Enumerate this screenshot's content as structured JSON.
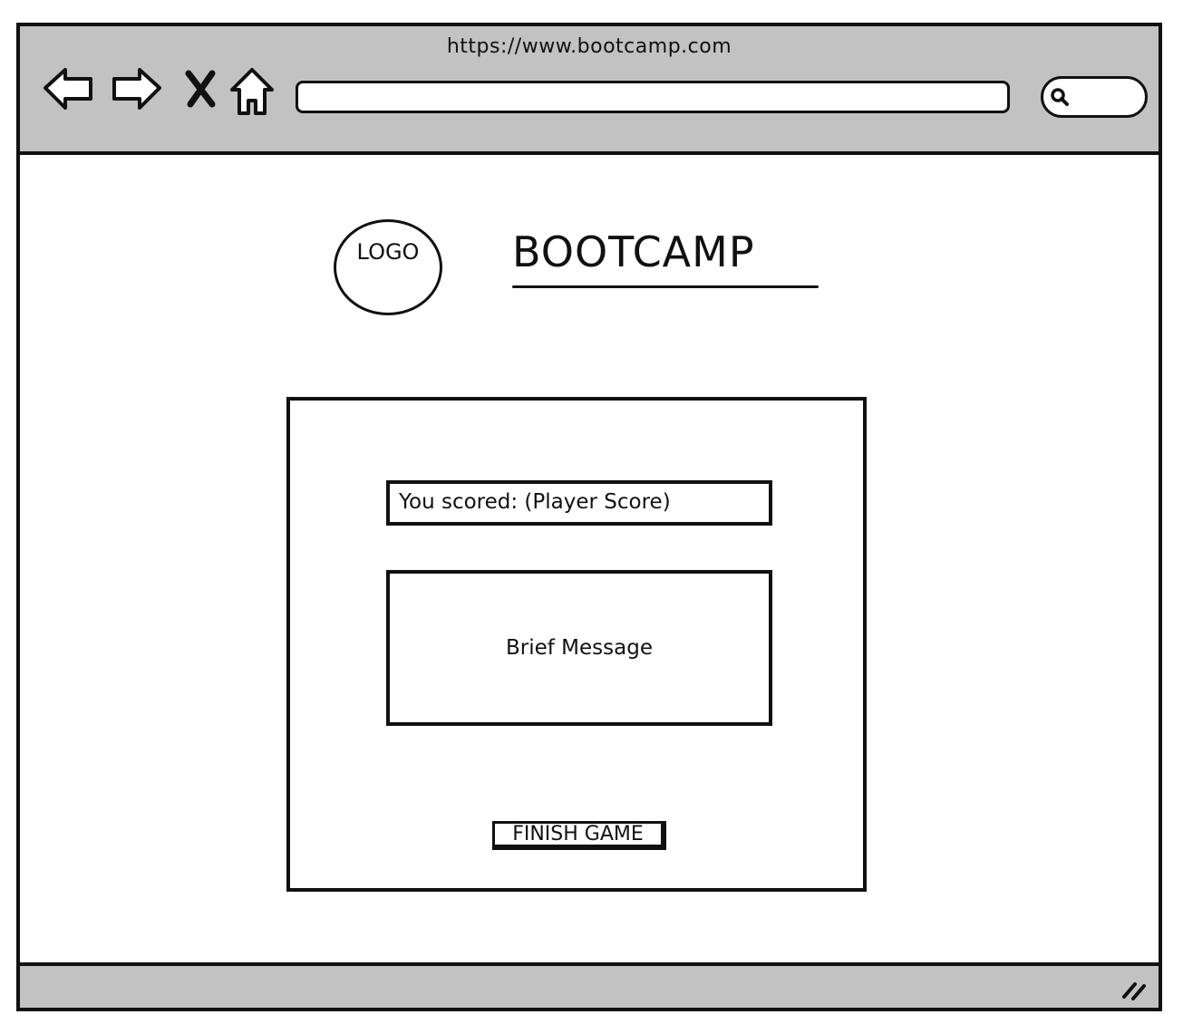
{
  "browser": {
    "url": "https://www.bootcamp.com",
    "address_value": "",
    "icons": [
      "back-arrow-icon",
      "forward-arrow-icon",
      "stop-icon",
      "home-icon",
      "search-icon",
      "resize-grip-icon"
    ]
  },
  "header": {
    "logo_text": "LOGO",
    "title": "BOOTCAMP"
  },
  "card": {
    "score_text": "You scored: (Player Score)",
    "message_text": "Brief Message",
    "finish_label": "FINISH GAME"
  },
  "colors": {
    "chrome_gray": "#c2c2c2",
    "stroke": "#111111",
    "background": "#ffffff"
  }
}
